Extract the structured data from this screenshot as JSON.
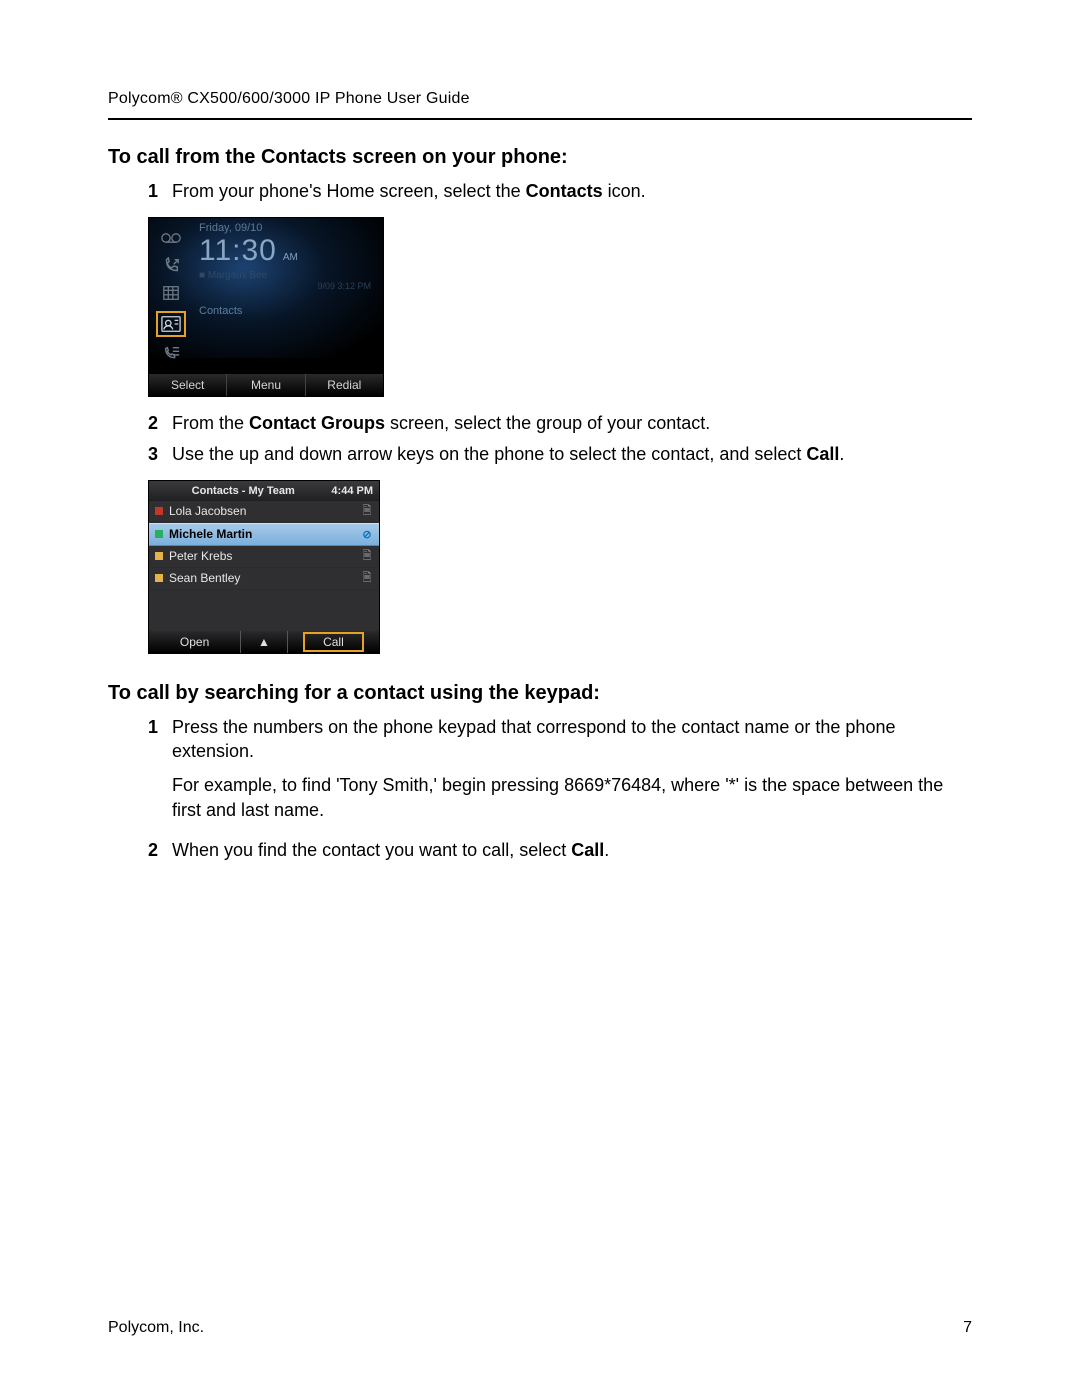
{
  "header": {
    "brand": "Polycom",
    "reg": "®",
    "title_suffix": " CX500/600/3000 IP Phone User Guide"
  },
  "sectionA": {
    "heading": "To call from the Contacts screen on your phone:",
    "step1_num": "1",
    "step1a": "From your phone's Home screen, select the ",
    "step1b_bold": "Contacts",
    "step1c": " icon.",
    "step2_num": "2",
    "step2a": "From the ",
    "step2b_bold": "Contact Groups",
    "step2c": " screen, select the group of your contact.",
    "step3_num": "3",
    "step3a": "Use the up and down arrow keys on the phone to select the contact, and select ",
    "step3b_bold": "Call",
    "step3c": "."
  },
  "phone1": {
    "date": "Friday, 09/10",
    "time": "11:30",
    "ampm": "AM",
    "sub1": "Margaux Bee",
    "sub2": "9/09 3:12 PM",
    "selected_label": "Contacts",
    "softkeys": {
      "left": "Select",
      "mid": "Menu",
      "right": "Redial"
    }
  },
  "phone2": {
    "title": "Contacts - My Team",
    "time": "4:44 PM",
    "rows": [
      {
        "presence": "busy",
        "name": "Lola Jacobsen",
        "right": "note",
        "selected": false
      },
      {
        "presence": "avail",
        "name": "Michele Martin",
        "right": "block",
        "selected": true
      },
      {
        "presence": "away",
        "name": "Peter Krebs",
        "right": "note",
        "selected": false
      },
      {
        "presence": "away",
        "name": "Sean Bentley",
        "right": "note",
        "selected": false
      }
    ],
    "softkeys": {
      "left": "Open",
      "mid": "▲",
      "right": "Call"
    }
  },
  "sectionB": {
    "heading": "To call by searching for a contact using the keypad:",
    "step1_num": "1",
    "step1_p1": "Press the numbers on the phone keypad that correspond to the contact name or the phone extension.",
    "step1_p2": "For example, to find 'Tony Smith,' begin pressing 8669*76484, where '*' is the space between the first and last name.",
    "step2_num": "2",
    "step2a": "When you find the contact you want to call, select ",
    "step2b_bold": "Call",
    "step2c": "."
  },
  "footer": {
    "left": "Polycom, Inc.",
    "right": "7"
  }
}
